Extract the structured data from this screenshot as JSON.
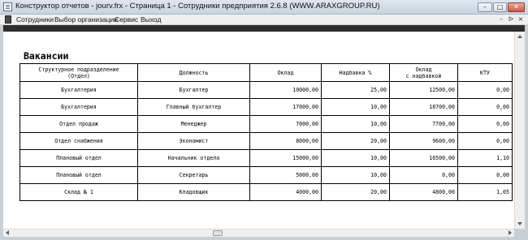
{
  "window": {
    "title": "Конструктор отчетов - jourv.frx - Страница 1 - Сотрудники предприятия 2.6.8  (WWW.ARAXGROUP.RU)",
    "btn_min": "–",
    "btn_max": "□",
    "btn_close": "✕"
  },
  "menu": {
    "items": [
      "Сотрудники",
      "Выбор организации",
      "Сервис",
      "Выход"
    ],
    "mdi": [
      "–",
      "ᐅ",
      "×"
    ]
  },
  "report": {
    "title": "Вакансии",
    "headers": {
      "dept_line1": "Структурное подразделение",
      "dept_line2": "(Отдел)",
      "position": "Должность",
      "salary": "Оклад",
      "bonus": "Надбавка %",
      "total_line1": "Оклад",
      "total_line2": "с надбавкой",
      "ktu": "КТУ"
    },
    "rows": [
      {
        "dept": "Бухгалтерия",
        "position": "Бухгалтер",
        "salary": "10000,00",
        "bonus": "25,00",
        "total": "12500,00",
        "ktu": "0,00"
      },
      {
        "dept": "Бухгалтерия",
        "position": "Главный бухгалтер",
        "salary": "17000,00",
        "bonus": "10,00",
        "total": "18700,00",
        "ktu": "0,00"
      },
      {
        "dept": "Отдел продаж",
        "position": "Менеджер",
        "salary": "7000,00",
        "bonus": "10,00",
        "total": "7700,00",
        "ktu": "0,00"
      },
      {
        "dept": "Отдел снабжения",
        "position": "Экономист",
        "salary": "8000,00",
        "bonus": "20,00",
        "total": "9600,00",
        "ktu": "0,00"
      },
      {
        "dept": "Плановый отдел",
        "position": "Начальник отдела",
        "salary": "15000,00",
        "bonus": "10,00",
        "total": "16500,00",
        "ktu": "1,10"
      },
      {
        "dept": "Плановый отдел",
        "position": "Секретарь",
        "salary": "5000,00",
        "bonus": "10,00",
        "total": "0,00",
        "ktu": "0,00"
      },
      {
        "dept": "Склад № 1",
        "position": "Кладовщик",
        "salary": "4000,00",
        "bonus": "20,00",
        "total": "4800,00",
        "ktu": "1,05"
      }
    ]
  }
}
